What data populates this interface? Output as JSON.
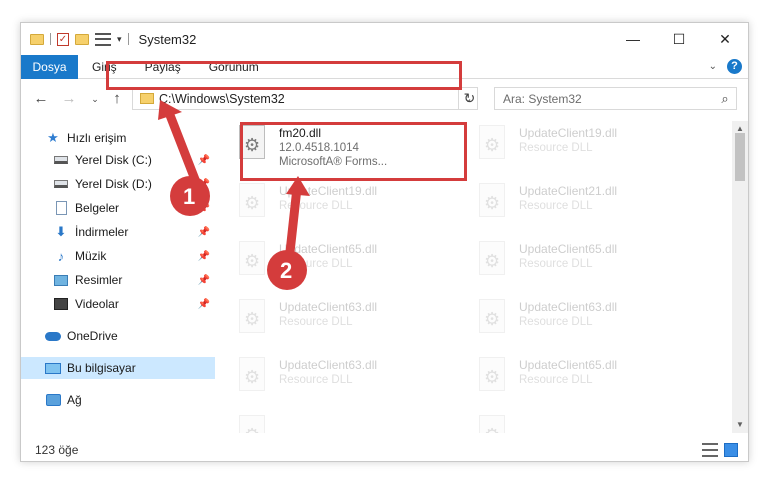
{
  "title": "System32",
  "window_controls": {
    "minimize": "—",
    "maximize": "☐",
    "close": "✕"
  },
  "ribbon": {
    "file_tab": "Dosya",
    "tabs": [
      "Giriş",
      "Paylaş",
      "Görünüm"
    ],
    "expand_chevron": "⌄",
    "help": "?"
  },
  "nav": {
    "back": "←",
    "forward": "→",
    "recent": "⌄",
    "up": "↑"
  },
  "address": {
    "path": "C:\\Windows\\System32",
    "dropdown": "⌄",
    "refresh": "↻"
  },
  "search": {
    "placeholder": "Ara: System32",
    "icon": "⌕"
  },
  "sidebar": {
    "items": [
      {
        "label": "Hızlı erişim"
      },
      {
        "label": "Yerel Disk (C:)",
        "pin": "📌"
      },
      {
        "label": "Yerel Disk (D:)",
        "pin": "📌"
      },
      {
        "label": "Belgeler",
        "pin": "📌"
      },
      {
        "label": "İndirmeler",
        "pin": "📌"
      },
      {
        "label": "Müzik",
        "pin": "📌"
      },
      {
        "label": "Resimler",
        "pin": "📌"
      },
      {
        "label": "Videolar",
        "pin": "📌"
      },
      {
        "label": "OneDrive"
      },
      {
        "label": "Bu bilgisayar"
      },
      {
        "label": "Ağ"
      }
    ]
  },
  "files": [
    {
      "name": "fm20.dll",
      "line2": "12.0.4518.1014",
      "line3": "MicrosoftA® Forms..."
    },
    {
      "name": "UpdateClient19.dll",
      "line2": "Resource DLL"
    },
    {
      "name": "UpdateClient19.dll",
      "line2": "Resource DLL"
    },
    {
      "name": "UpdateClient21.dll",
      "line2": "Resource DLL"
    },
    {
      "name": "UpdateClient65.dll",
      "line2": "Resource DLL"
    },
    {
      "name": "UpdateClient65.dll",
      "line2": "Resource DLL"
    },
    {
      "name": "UpdateClient63.dll",
      "line2": "Resource DLL"
    },
    {
      "name": "UpdateClient63.dll",
      "line2": "Resource DLL"
    },
    {
      "name": "UpdateClient63.dll",
      "line2": "Resource DLL"
    },
    {
      "name": "UpdateClient65.dll",
      "line2": "Resource DLL"
    },
    {
      "name": "",
      "line2": ""
    },
    {
      "name": "",
      "line2": ""
    }
  ],
  "status": {
    "count": "123 öğe"
  },
  "annotations": {
    "step1": "1",
    "step2": "2",
    "color": "#d43c3c"
  }
}
